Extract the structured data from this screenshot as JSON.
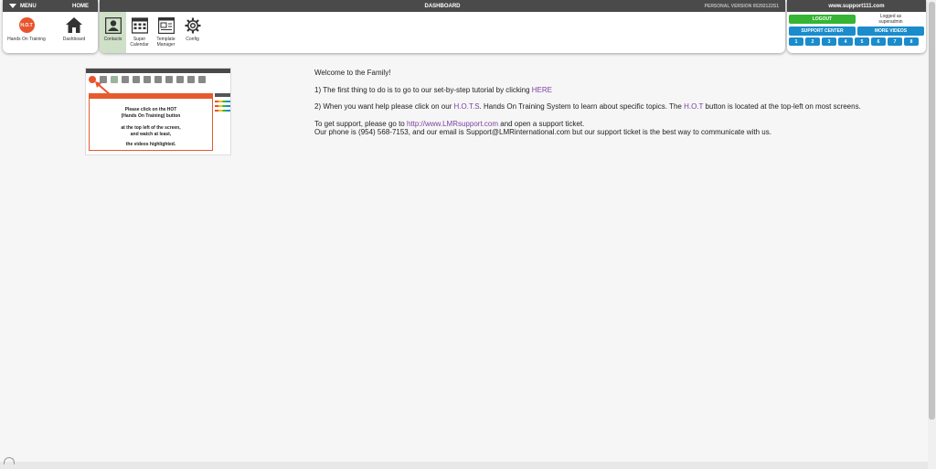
{
  "left_panel": {
    "menu_label": "MENU",
    "home_label": "HOME",
    "hot_badge_text": "H.O.T",
    "items": [
      {
        "label": "Hands On Training",
        "icon": "hot-badge"
      },
      {
        "label": "Dashboard",
        "icon": "house-icon"
      }
    ]
  },
  "center_panel": {
    "title": "DASHBOARD",
    "version": "PERSONAL VERSION 05292122S1",
    "tools": [
      {
        "label": "Contacts",
        "icon": "contacts-icon",
        "active": true
      },
      {
        "label": "Super Calendar",
        "icon": "calendar-icon"
      },
      {
        "label": "Template Manager",
        "icon": "template-icon"
      },
      {
        "label": "Config",
        "icon": "gear-icon"
      }
    ]
  },
  "right_panel": {
    "site": "www.support111.com",
    "logout_label": "LOGOUT",
    "logged_as_label": "Logged as",
    "username": "superadmin",
    "support_center_label": "SUPPORT CENTER",
    "more_videos_label": "MORE VIDEOS",
    "numbers": [
      "1",
      "2",
      "3",
      "4",
      "5",
      "6",
      "7",
      "8"
    ]
  },
  "thumbnail": {
    "message_line1": "Please click on the HOT",
    "message_line2": "(Hands On Training) button",
    "message_line3": "at the top left of the screen,",
    "message_line4": "and watch at least,",
    "message_line5": "the videos highlighted."
  },
  "welcome": {
    "heading": "Welcome to the Family!",
    "step1_text": "1) The first thing to do is to go to our set-by-step tutorial by clicking ",
    "step1_link": "HERE",
    "step2_pre": "2) When you want help please click on our ",
    "step2_link1": "H.O.T.S",
    "step2_mid": ". Hands On Training System to learn about specific topics. The ",
    "step2_link2": "H.O.T",
    "step2_post": " button is located at the top-left on most screens.",
    "support_pre": "To get support, please go to ",
    "support_link": "http://www.LMRsupport.com",
    "support_post": " and open a support ticket.",
    "contact_line": "Our phone is (954) 568-7153, and our email is Support@LMRinternational.com but our support ticket is the best way to communicate with us."
  },
  "colors": {
    "header_bar": "#4a4a4a",
    "logout_green": "#35b533",
    "button_blue": "#1a8ccc",
    "hot_orange": "#e8542e",
    "link_purple": "#7d3fa0",
    "active_tool": "#cfe0c8"
  }
}
